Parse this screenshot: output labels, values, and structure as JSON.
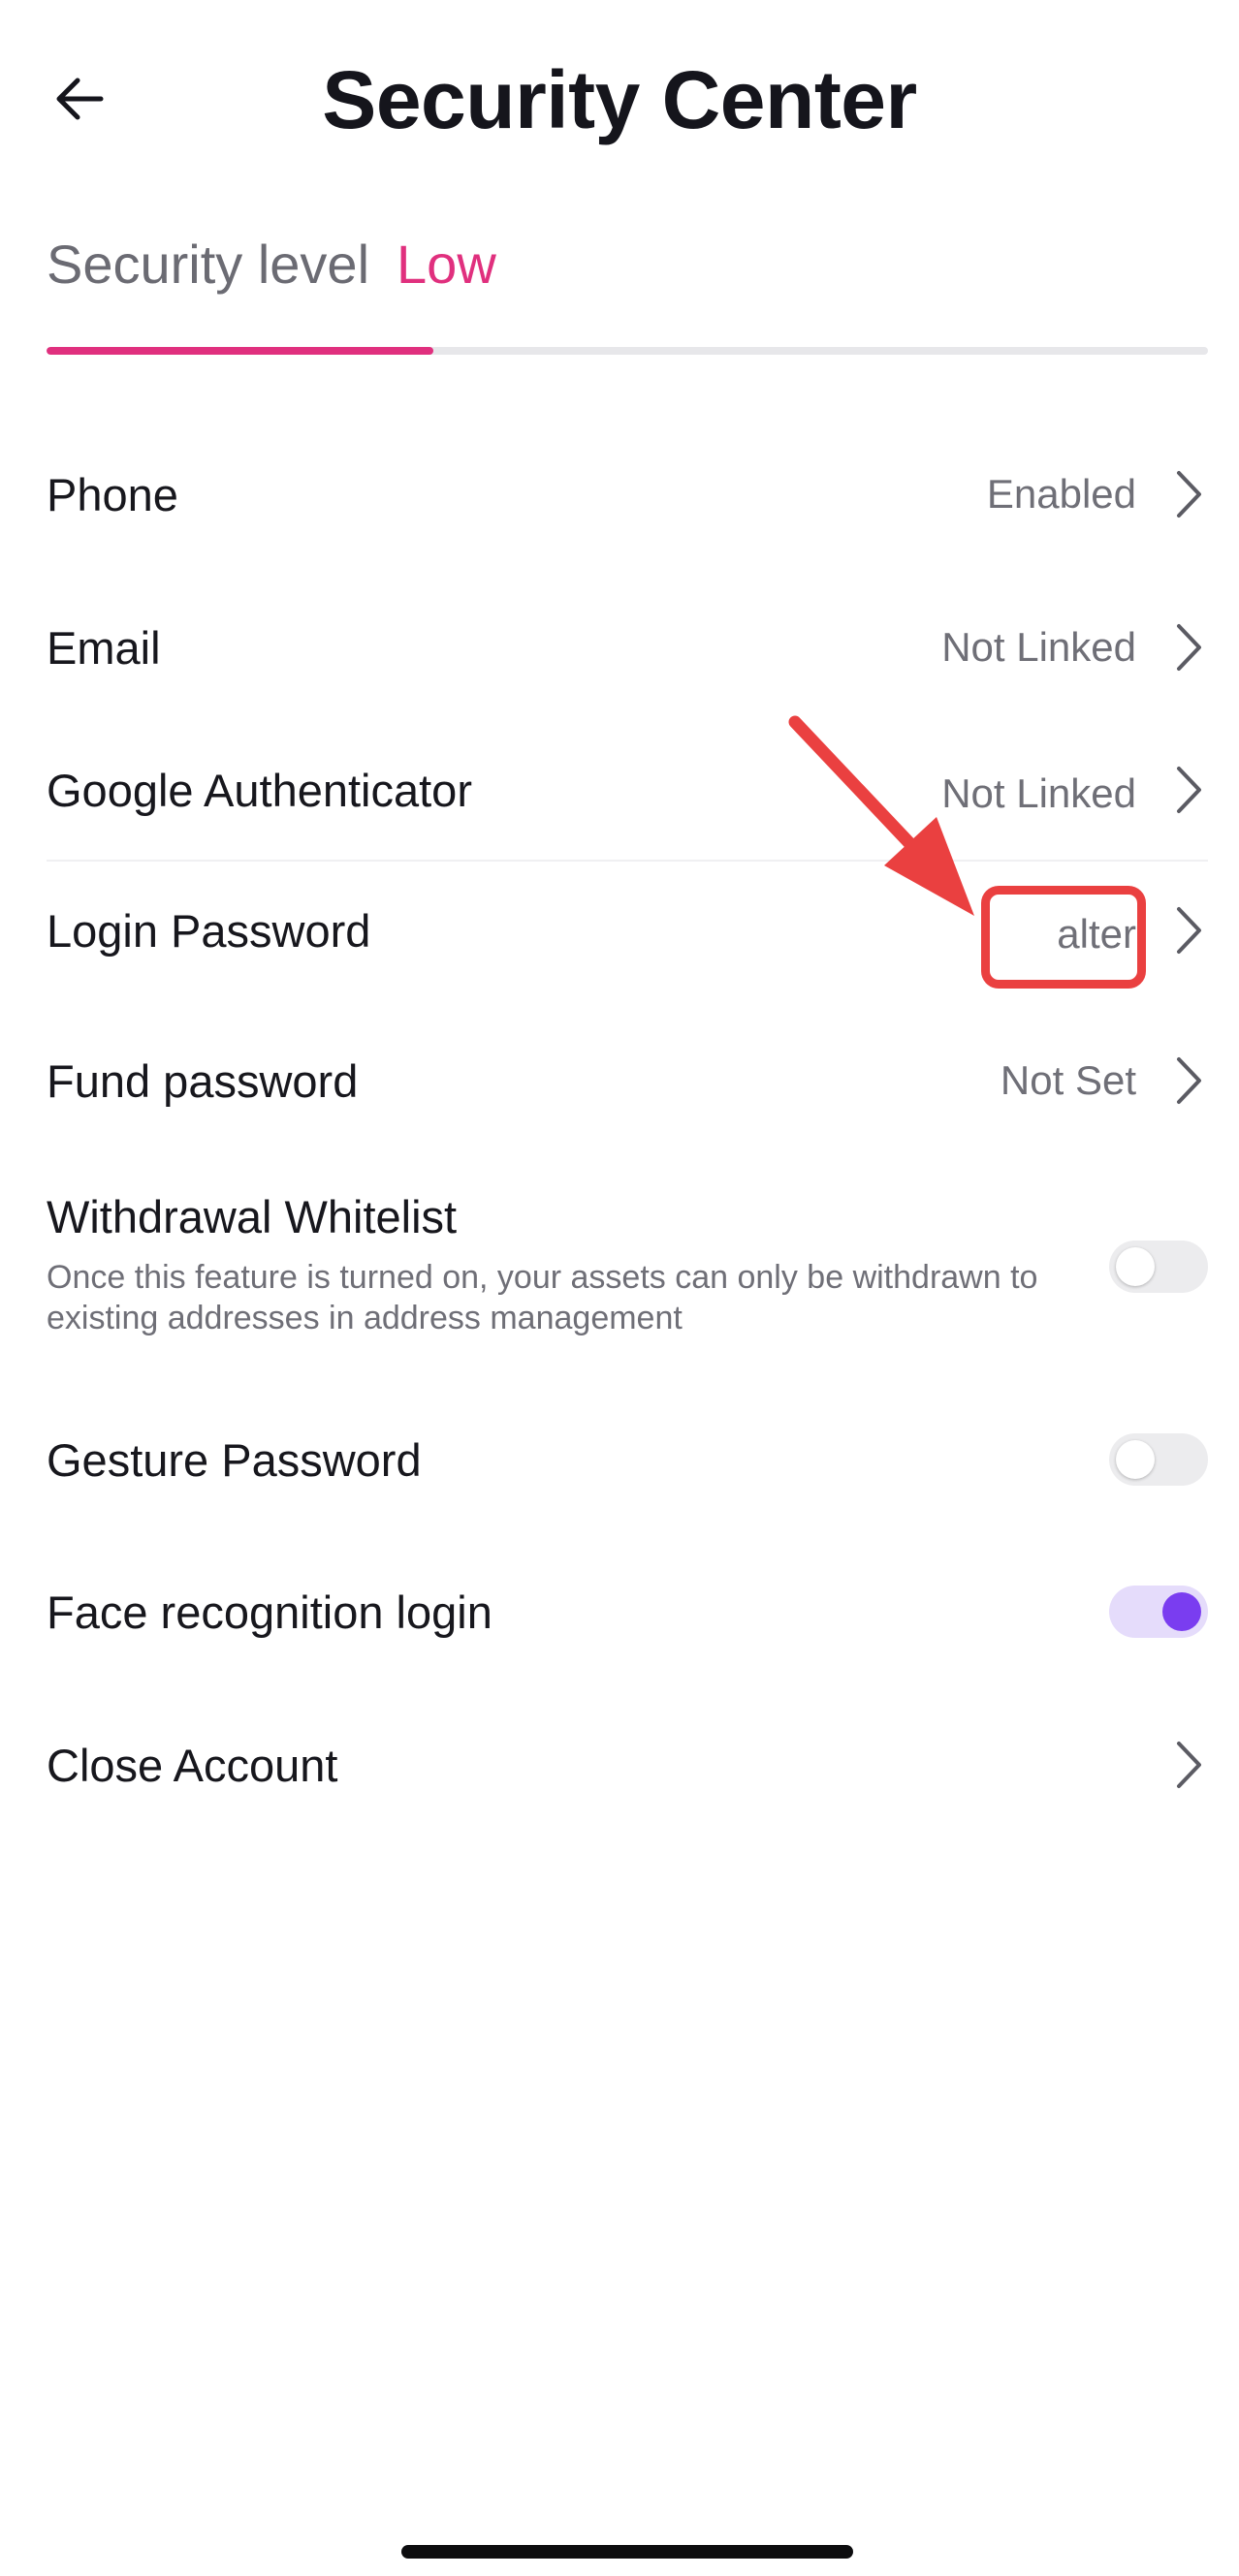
{
  "header": {
    "title": "Security Center",
    "back_icon": "arrow-left-icon"
  },
  "security_level": {
    "label": "Security level",
    "value": "Low",
    "progress": 0.333,
    "accent_color": "#e0307e"
  },
  "rows": {
    "phone": {
      "label": "Phone",
      "value": "Enabled"
    },
    "email": {
      "label": "Email",
      "value": "Not Linked"
    },
    "google_auth": {
      "label": "Google Authenticator",
      "value": "Not Linked"
    },
    "login_password": {
      "label": "Login Password",
      "value": "alter"
    },
    "fund_password": {
      "label": "Fund password",
      "value": "Not Set"
    },
    "close_account": {
      "label": "Close Account"
    }
  },
  "toggles": {
    "withdrawal_whitelist": {
      "label": "Withdrawal Whitelist",
      "description": "Once this feature is turned on, your assets can only be withdrawn to existing addresses in address management",
      "on": false
    },
    "gesture_password": {
      "label": "Gesture Password",
      "on": false
    },
    "face_login": {
      "label": "Face recognition login",
      "on": true,
      "on_color": "#7a3df0"
    }
  },
  "annotation": {
    "color": "#ea4040",
    "target": "login-password-value"
  }
}
